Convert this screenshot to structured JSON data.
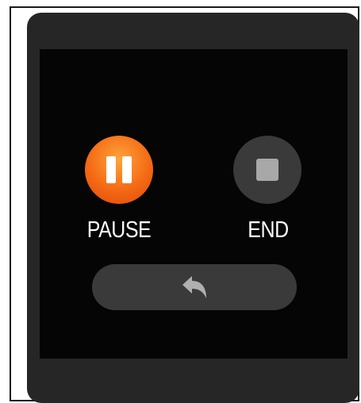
{
  "controls": {
    "pause": {
      "label": "PAUSE",
      "icon": "pause-icon",
      "color": "#f46a14"
    },
    "end": {
      "label": "END",
      "icon": "stop-icon",
      "color": "#3a3a3a"
    },
    "back": {
      "icon": "back-arrow-icon"
    }
  }
}
